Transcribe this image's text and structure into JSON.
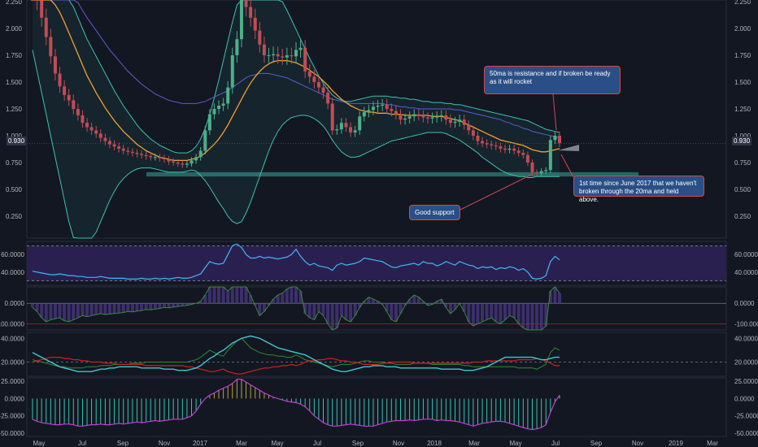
{
  "chart_data": {
    "type": "candlestick",
    "price_ticks": [
      "2.250",
      "2.000",
      "1.750",
      "1.500",
      "1.250",
      "1.000",
      "0.750",
      "0.500",
      "0.250"
    ],
    "last_price": "0.930",
    "time_ticks": [
      "May",
      "Jul",
      "Sep",
      "Nov",
      "2017",
      "Mar",
      "May",
      "Jul",
      "Sep",
      "Nov",
      "2018",
      "Mar",
      "May",
      "Jul",
      "Sep",
      "Nov",
      "2019",
      "Mar"
    ],
    "support_zone": [
      0.62,
      0.66
    ],
    "close": [
      2.35,
      2.26,
      2.1,
      1.92,
      1.74,
      1.58,
      1.46,
      1.38,
      1.33,
      1.25,
      1.19,
      1.12,
      1.08,
      1.05,
      1.02,
      0.98,
      0.95,
      0.92,
      0.9,
      0.88,
      0.86,
      0.85,
      0.84,
      0.83,
      0.82,
      0.81,
      0.8,
      0.8,
      0.79,
      0.78,
      0.76,
      0.75,
      0.74,
      0.73,
      0.74,
      0.77,
      0.8,
      0.86,
      1.05,
      1.2,
      1.25,
      1.28,
      1.3,
      1.45,
      1.75,
      1.9,
      2.3,
      2.2,
      2.1,
      1.98,
      1.85,
      1.75,
      1.75,
      1.76,
      1.74,
      1.73,
      1.75,
      1.74,
      1.8,
      1.82,
      1.6,
      1.55,
      1.5,
      1.45,
      1.4,
      1.3,
      1.05,
      1.06,
      1.12,
      1.08,
      1.03,
      1.05,
      1.18,
      1.22,
      1.24,
      1.27,
      1.28,
      1.29,
      1.25,
      1.23,
      1.2,
      1.15,
      1.16,
      1.18,
      1.2,
      1.19,
      1.17,
      1.16,
      1.17,
      1.18,
      1.19,
      1.15,
      1.12,
      1.13,
      1.15,
      1.1,
      1.05,
      1.0,
      0.95,
      0.93,
      0.92,
      0.91,
      0.9,
      0.88,
      0.87,
      0.88,
      0.86,
      0.84,
      0.82,
      0.75,
      0.66,
      0.65,
      0.67,
      0.68,
      0.96,
      1.0,
      0.93
    ],
    "ma20": [
      2.4,
      2.38,
      2.35,
      2.32,
      2.28,
      2.22,
      2.15,
      2.06,
      1.96,
      1.86,
      1.76,
      1.66,
      1.56,
      1.48,
      1.4,
      1.33,
      1.26,
      1.2,
      1.14,
      1.09,
      1.04,
      1.0,
      0.96,
      0.92,
      0.89,
      0.86,
      0.84,
      0.82,
      0.8,
      0.79,
      0.78,
      0.77,
      0.77,
      0.77,
      0.77,
      0.78,
      0.79,
      0.81,
      0.84,
      0.88,
      0.92,
      0.97,
      1.03,
      1.1,
      1.18,
      1.26,
      1.34,
      1.42,
      1.49,
      1.55,
      1.6,
      1.64,
      1.67,
      1.69,
      1.7,
      1.7,
      1.7,
      1.69,
      1.68,
      1.66,
      1.64,
      1.61,
      1.58,
      1.55,
      1.51,
      1.47,
      1.42,
      1.38,
      1.34,
      1.31,
      1.28,
      1.26,
      1.24,
      1.23,
      1.22,
      1.22,
      1.21,
      1.21,
      1.21,
      1.2,
      1.2,
      1.2,
      1.19,
      1.19,
      1.19,
      1.19,
      1.19,
      1.19,
      1.18,
      1.18,
      1.18,
      1.17,
      1.16,
      1.15,
      1.14,
      1.12,
      1.1,
      1.08,
      1.06,
      1.04,
      1.02,
      1.0,
      0.98,
      0.96,
      0.95,
      0.94,
      0.93,
      0.92,
      0.91,
      0.89,
      0.87,
      0.86,
      0.85,
      0.85,
      0.86,
      0.87,
      0.88
    ],
    "ma50": [
      2.9,
      2.85,
      2.8,
      2.74,
      2.68,
      2.6,
      2.52,
      2.45,
      2.38,
      2.31,
      2.24,
      2.17,
      2.1,
      2.04,
      1.98,
      1.92,
      1.86,
      1.8,
      1.75,
      1.7,
      1.65,
      1.6,
      1.56,
      1.52,
      1.48,
      1.45,
      1.42,
      1.39,
      1.37,
      1.35,
      1.33,
      1.32,
      1.31,
      1.3,
      1.3,
      1.3,
      1.3,
      1.31,
      1.32,
      1.34,
      1.36,
      1.38,
      1.4,
      1.42,
      1.45,
      1.48,
      1.51,
      1.54,
      1.56,
      1.57,
      1.58,
      1.58,
      1.58,
      1.57,
      1.56,
      1.55,
      1.54,
      1.52,
      1.5,
      1.48,
      1.46,
      1.44,
      1.42,
      1.4,
      1.38,
      1.36,
      1.34,
      1.33,
      1.32,
      1.31,
      1.3,
      1.3,
      1.3,
      1.3,
      1.3,
      1.3,
      1.3,
      1.3,
      1.29,
      1.29,
      1.28,
      1.27,
      1.27,
      1.26,
      1.26,
      1.25,
      1.25,
      1.25,
      1.25,
      1.25,
      1.25,
      1.25,
      1.25,
      1.24,
      1.24,
      1.23,
      1.22,
      1.21,
      1.2,
      1.19,
      1.18,
      1.17,
      1.16,
      1.15,
      1.13,
      1.12,
      1.1,
      1.09,
      1.07,
      1.06,
      1.04,
      1.03,
      1.02,
      1.01,
      1.0,
      0.99,
      0.98
    ],
    "bb_upper": [
      3.0,
      2.95,
      2.9,
      2.8,
      2.7,
      2.6,
      2.5,
      2.4,
      2.3,
      2.2,
      2.1,
      2.0,
      1.9,
      1.82,
      1.74,
      1.66,
      1.58,
      1.5,
      1.42,
      1.35,
      1.28,
      1.22,
      1.16,
      1.1,
      1.05,
      1.01,
      0.97,
      0.94,
      0.91,
      0.89,
      0.87,
      0.85,
      0.84,
      0.84,
      0.84,
      0.86,
      0.9,
      0.97,
      1.07,
      1.2,
      1.35,
      1.52,
      1.7,
      1.88,
      2.06,
      2.22,
      2.36,
      2.46,
      2.52,
      2.54,
      2.53,
      2.5,
      2.46,
      2.4,
      2.33,
      2.25,
      2.17,
      2.08,
      1.99,
      1.9,
      1.81,
      1.72,
      1.64,
      1.56,
      1.49,
      1.43,
      1.38,
      1.35,
      1.33,
      1.32,
      1.32,
      1.33,
      1.34,
      1.35,
      1.36,
      1.37,
      1.37,
      1.37,
      1.37,
      1.36,
      1.36,
      1.35,
      1.35,
      1.34,
      1.34,
      1.33,
      1.32,
      1.32,
      1.31,
      1.31,
      1.31,
      1.3,
      1.3,
      1.29,
      1.29,
      1.28,
      1.27,
      1.26,
      1.25,
      1.24,
      1.23,
      1.22,
      1.21,
      1.2,
      1.19,
      1.18,
      1.17,
      1.16,
      1.15,
      1.14,
      1.12,
      1.1,
      1.08,
      1.06,
      1.05,
      1.04,
      1.03
    ],
    "bb_lower": [
      1.8,
      1.6,
      1.4,
      1.2,
      1.0,
      0.8,
      0.6,
      0.4,
      0.2,
      0.05,
      0.0,
      0.0,
      0.0,
      0.02,
      0.1,
      0.2,
      0.3,
      0.4,
      0.48,
      0.55,
      0.6,
      0.64,
      0.67,
      0.69,
      0.7,
      0.7,
      0.7,
      0.69,
      0.68,
      0.67,
      0.66,
      0.66,
      0.66,
      0.66,
      0.67,
      0.68,
      0.67,
      0.63,
      0.58,
      0.52,
      0.45,
      0.38,
      0.32,
      0.25,
      0.2,
      0.18,
      0.2,
      0.28,
      0.38,
      0.5,
      0.62,
      0.74,
      0.86,
      0.96,
      1.04,
      1.1,
      1.14,
      1.17,
      1.18,
      1.19,
      1.19,
      1.18,
      1.16,
      1.13,
      1.09,
      1.03,
      0.96,
      0.9,
      0.85,
      0.82,
      0.8,
      0.8,
      0.81,
      0.83,
      0.85,
      0.87,
      0.89,
      0.91,
      0.93,
      0.95,
      0.96,
      0.97,
      0.98,
      0.99,
      1.0,
      1.01,
      1.02,
      1.03,
      1.03,
      1.03,
      1.03,
      1.02,
      1.0,
      0.98,
      0.96,
      0.93,
      0.9,
      0.87,
      0.84,
      0.8,
      0.77,
      0.74,
      0.71,
      0.68,
      0.66,
      0.64,
      0.63,
      0.62,
      0.62,
      0.61,
      0.61,
      0.62,
      0.62,
      0.62,
      0.62,
      0.62,
      0.62
    ],
    "rsi": {
      "ticks": [
        "60.0000",
        "40.0000"
      ],
      "values": [
        41,
        40,
        39,
        38,
        37,
        37,
        38,
        37,
        36,
        36,
        35,
        35,
        34,
        34,
        34,
        35,
        34,
        33,
        33,
        33,
        33,
        32,
        32,
        32,
        33,
        32,
        32,
        33,
        32,
        33,
        32,
        33,
        34,
        33,
        33,
        34,
        36,
        38,
        45,
        52,
        50,
        49,
        50,
        60,
        70,
        72,
        68,
        60,
        56,
        56,
        58,
        56,
        57,
        56,
        55,
        56,
        57,
        60,
        66,
        58,
        52,
        48,
        50,
        47,
        46,
        45,
        42,
        48,
        50,
        48,
        49,
        50,
        52,
        56,
        55,
        54,
        53,
        52,
        49,
        46,
        45,
        47,
        48,
        49,
        50,
        48,
        52,
        50,
        50,
        47,
        49,
        52,
        50,
        48,
        52,
        50,
        48,
        47,
        44,
        46,
        45,
        46,
        43,
        45,
        44,
        46,
        45,
        42,
        44,
        40,
        33,
        32,
        33,
        36,
        52,
        58,
        54
      ]
    },
    "cci": {
      "ticks": [
        "0.0000",
        "-100.0000"
      ],
      "values": [
        -20,
        -40,
        -70,
        -90,
        -80,
        -75,
        -70,
        -85,
        -90,
        -80,
        -70,
        -60,
        -65,
        -60,
        -55,
        -50,
        -55,
        -52,
        -50,
        -48,
        -45,
        -40,
        -42,
        -38,
        -35,
        -30,
        -32,
        -28,
        -25,
        -20,
        -22,
        -18,
        -15,
        -12,
        -10,
        -5,
        0,
        10,
        40,
        80,
        120,
        110,
        90,
        60,
        80,
        150,
        200,
        120,
        40,
        -10,
        -60,
        -40,
        -10,
        20,
        40,
        50,
        70,
        90,
        140,
        60,
        -50,
        -70,
        -80,
        -40,
        -60,
        -100,
        -160,
        -120,
        -60,
        -80,
        -90,
        -60,
        -20,
        10,
        30,
        20,
        10,
        -5,
        -40,
        -80,
        -90,
        -50,
        -10,
        20,
        40,
        30,
        10,
        -10,
        -5,
        10,
        20,
        -20,
        -50,
        -30,
        0,
        -40,
        -90,
        -110,
        -100,
        -90,
        -80,
        -70,
        -90,
        -100,
        -80,
        -60,
        -70,
        -100,
        -120,
        -140,
        -170,
        -160,
        -130,
        -110,
        60,
        100,
        50
      ]
    },
    "dmi": {
      "ticks": [
        "40.0000",
        "20.0000"
      ],
      "adx": [
        28,
        26,
        24,
        22,
        20,
        18,
        16,
        15,
        14,
        13,
        12,
        12,
        12,
        12,
        13,
        14,
        14,
        15,
        15,
        16,
        16,
        16,
        16,
        16,
        15,
        15,
        15,
        15,
        15,
        14,
        14,
        14,
        13,
        13,
        13,
        14,
        15,
        17,
        20,
        23,
        25,
        28,
        30,
        33,
        36,
        38,
        40,
        41,
        42,
        41,
        40,
        38,
        36,
        34,
        32,
        31,
        30,
        29,
        28,
        27,
        26,
        24,
        22,
        20,
        18,
        16,
        14,
        13,
        12,
        12,
        13,
        14,
        15,
        16,
        16,
        17,
        17,
        17,
        16,
        16,
        16,
        15,
        15,
        15,
        15,
        15,
        15,
        15,
        15,
        15,
        14,
        14,
        14,
        14,
        14,
        13,
        13,
        13,
        14,
        15,
        16,
        18,
        20,
        22,
        24,
        24,
        24,
        24,
        24,
        24,
        24,
        23,
        22,
        22,
        23,
        24,
        24
      ],
      "plus_di": [
        22,
        21,
        20,
        19,
        18,
        17,
        16,
        16,
        15,
        15,
        15,
        15,
        16,
        16,
        16,
        17,
        17,
        17,
        18,
        18,
        18,
        18,
        19,
        19,
        19,
        20,
        20,
        20,
        20,
        20,
        20,
        20,
        20,
        20,
        20,
        21,
        22,
        24,
        27,
        30,
        28,
        26,
        25,
        30,
        34,
        38,
        40,
        36,
        32,
        30,
        28,
        27,
        26,
        26,
        25,
        25,
        24,
        24,
        26,
        24,
        22,
        21,
        20,
        19,
        18,
        17,
        16,
        17,
        18,
        18,
        18,
        19,
        20,
        21,
        21,
        20,
        20,
        20,
        19,
        19,
        18,
        18,
        18,
        18,
        19,
        19,
        19,
        19,
        18,
        18,
        18,
        18,
        18,
        18,
        18,
        17,
        17,
        16,
        16,
        16,
        16,
        16,
        16,
        16,
        16,
        16,
        16,
        15,
        15,
        15,
        15,
        14,
        16,
        18,
        28,
        32,
        30
      ],
      "minus_di": [
        20,
        21,
        22,
        23,
        24,
        24,
        24,
        23,
        23,
        22,
        22,
        21,
        21,
        20,
        20,
        20,
        19,
        19,
        19,
        18,
        18,
        18,
        18,
        18,
        18,
        17,
        17,
        17,
        17,
        17,
        17,
        17,
        17,
        17,
        16,
        16,
        15,
        14,
        13,
        12,
        12,
        13,
        14,
        12,
        11,
        10,
        10,
        11,
        12,
        13,
        14,
        15,
        15,
        16,
        16,
        17,
        17,
        18,
        17,
        18,
        20,
        21,
        21,
        22,
        22,
        23,
        23,
        22,
        21,
        21,
        20,
        20,
        19,
        18,
        18,
        18,
        18,
        19,
        19,
        20,
        20,
        20,
        20,
        20,
        19,
        19,
        19,
        19,
        19,
        19,
        19,
        19,
        19,
        19,
        19,
        19,
        19,
        20,
        20,
        20,
        21,
        21,
        21,
        21,
        21,
        21,
        21,
        22,
        22,
        22,
        22,
        23,
        22,
        21,
        19,
        17,
        17
      ]
    },
    "momentum": {
      "ticks": [
        "25.0000",
        "0.0000",
        "-25.0000",
        "-50.0000"
      ],
      "values": [
        -30,
        -33,
        -35,
        -36,
        -37,
        -38,
        -38,
        -37,
        -37,
        -38,
        -40,
        -40,
        -39,
        -38,
        -38,
        -37,
        -38,
        -38,
        -37,
        -36,
        -37,
        -36,
        -35,
        -34,
        -35,
        -34,
        -33,
        -32,
        -33,
        -32,
        -31,
        -30,
        -30,
        -30,
        -28,
        -25,
        -18,
        -8,
        0,
        5,
        8,
        12,
        15,
        18,
        22,
        28,
        28,
        24,
        20,
        16,
        12,
        8,
        5,
        2,
        0,
        -2,
        -4,
        -5,
        -6,
        -8,
        -12,
        -18,
        -25,
        -30,
        -35,
        -38,
        -40,
        -40,
        -39,
        -38,
        -37,
        -38,
        -39,
        -40,
        -40,
        -40,
        -38,
        -36,
        -34,
        -33,
        -32,
        -32,
        -32,
        -31,
        -32,
        -31,
        -30,
        -30,
        -30,
        -32,
        -31,
        -32,
        -32,
        -33,
        -34,
        -36,
        -38,
        -40,
        -38,
        -36,
        -35,
        -34,
        -33,
        -33,
        -34,
        -36,
        -38,
        -40,
        -42,
        -44,
        -45,
        -44,
        -42,
        -38,
        -20,
        -5,
        5
      ]
    }
  },
  "annotations": [
    {
      "text": "50ma is resistance and if broken be ready as it will rocket"
    },
    {
      "text": "1st time since June 2017 that we haven't broken through the 20ma and held above."
    },
    {
      "text": "Good support"
    }
  ],
  "colors": {
    "bg": "#131722",
    "up": "#4cb08a",
    "down": "#c14c55",
    "ma20": "#f0a030",
    "ma50": "#5a5fd0",
    "ma_fast": "#d0d0d0",
    "bb": "#3cc3b0",
    "support": "#2a7a74",
    "rsi_band": "#2a2050",
    "rsi_line": "#3fb7f5",
    "adx": "#3cc8d0",
    "plus_di": "#2f8a2f",
    "minus_di": "#d02020",
    "momentum": "#c040d0"
  }
}
